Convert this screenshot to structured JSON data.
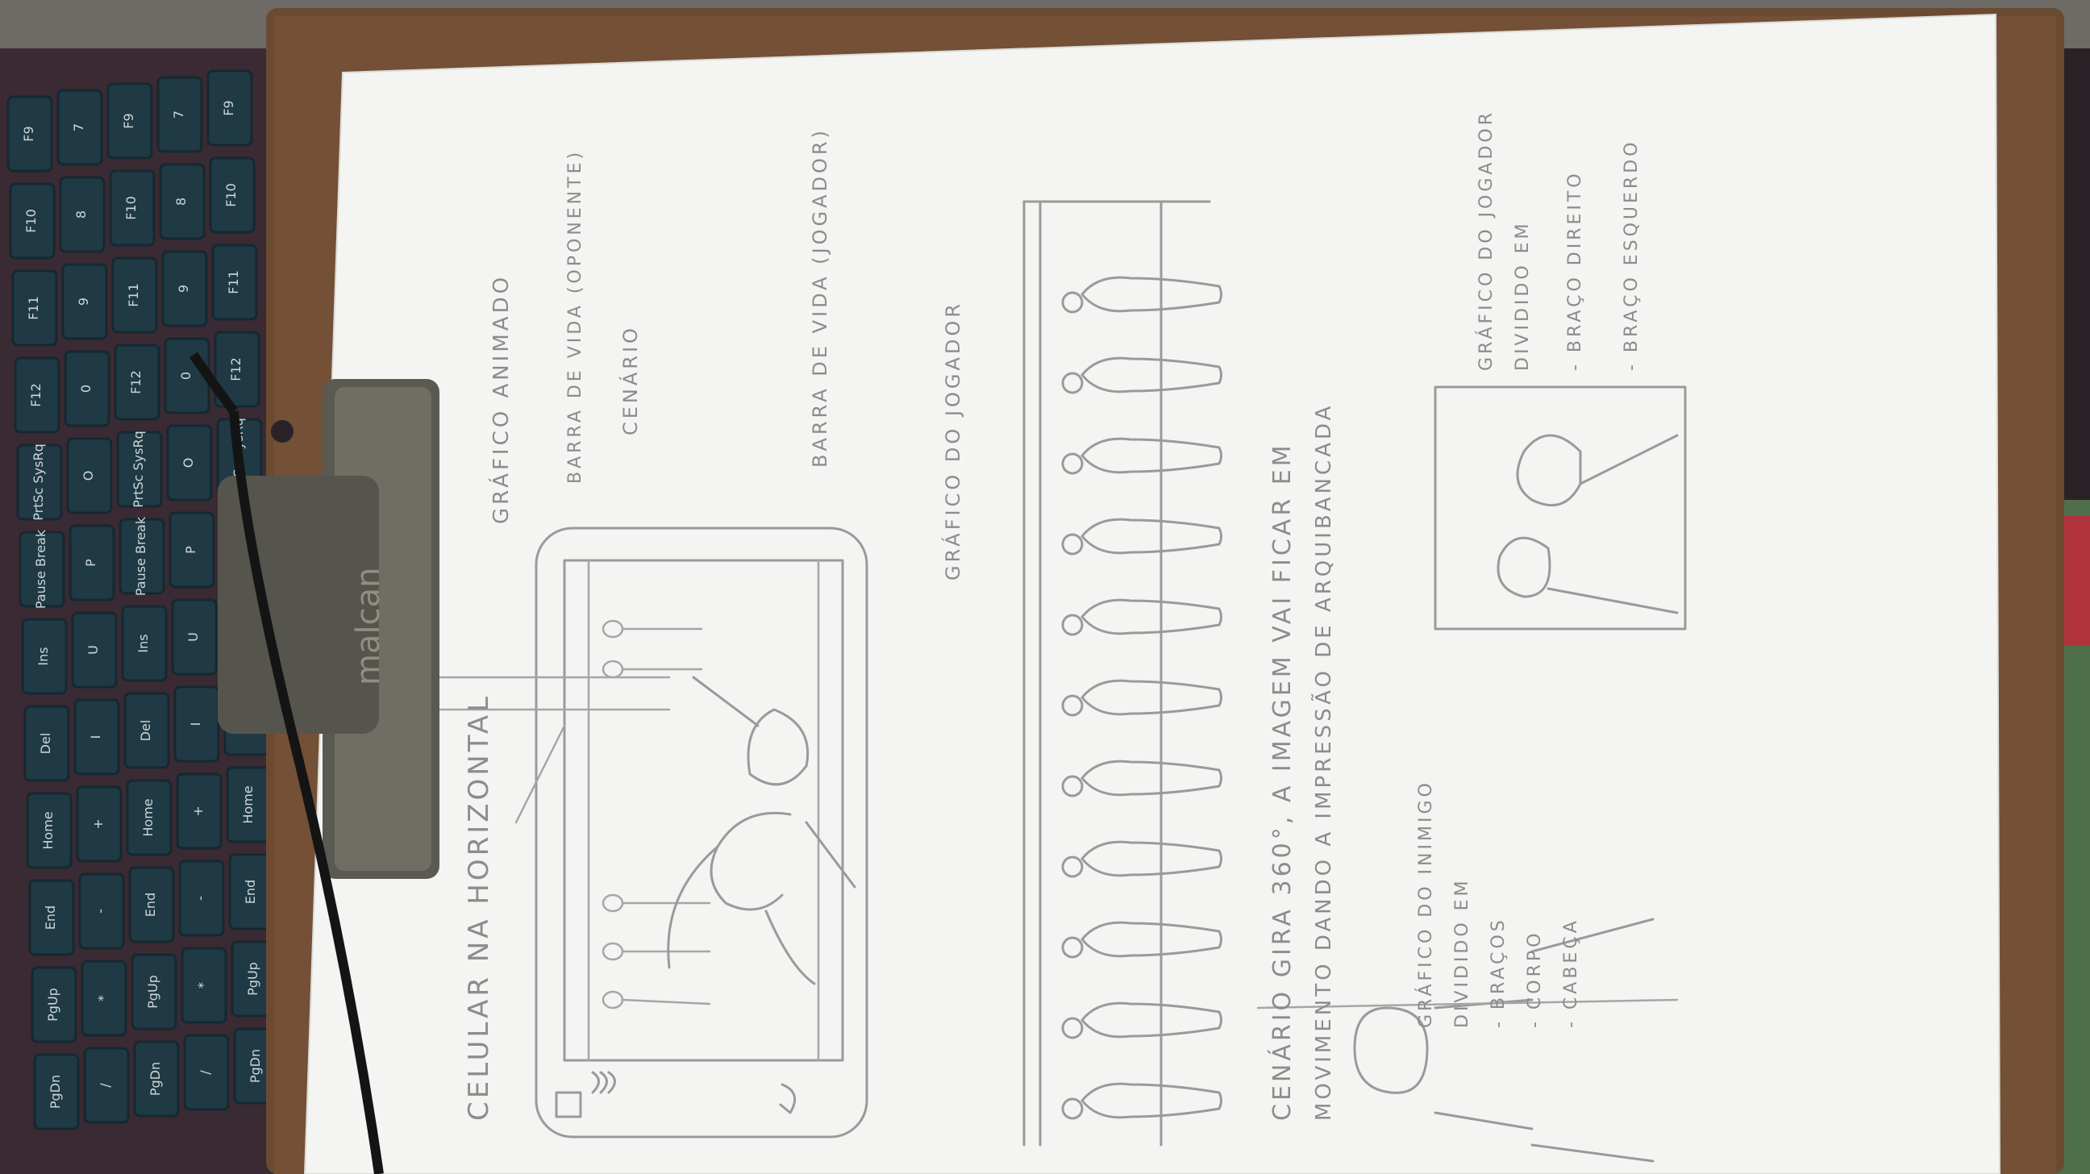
{
  "clip_brand": "malcan",
  "keys": [
    "F9",
    "F10",
    "F11",
    "F12",
    "PrtSc SysRq",
    "Pause Break",
    "Ins",
    "Del",
    "Home",
    "End",
    "PgUp",
    "PgDn",
    "7",
    "8",
    "9",
    "0",
    "O",
    "P",
    "U",
    "I",
    "+",
    "-",
    "*",
    "/"
  ],
  "notes": {
    "title": "CELULAR NA HORIZONTAL",
    "label_grafico_animado": "GRÁFICO ANIMADO",
    "label_barra_vida_oponente": "BARRA DE VIDA (OPONENTE)",
    "label_cenario": "CENÁRIO",
    "label_barra_vida_jogador": "BARRA DE VIDA (JOGADOR)",
    "label_grafico_jogador": "GRÁFICO DO JOGADOR",
    "caption_line1": "CENÁRIO GIRA 360°, A IMAGEM VAI FICAR EM",
    "caption_line2": "MOVIMENTO DANDO A IMPRESSÃO DE ARQUIBANCADA",
    "left_notes": [
      "GRÁFICO DO INIMIGO",
      "DIVIDIDO EM",
      "- BRAÇOS",
      "- CORPO",
      "- CABEÇA"
    ],
    "right_notes": [
      "GRÁFICO DO JOGADOR",
      "DIVIDIDO EM",
      "- BRAÇO DIREITO",
      "- BRAÇO ESQUERDO"
    ]
  },
  "crowd_count": 11
}
